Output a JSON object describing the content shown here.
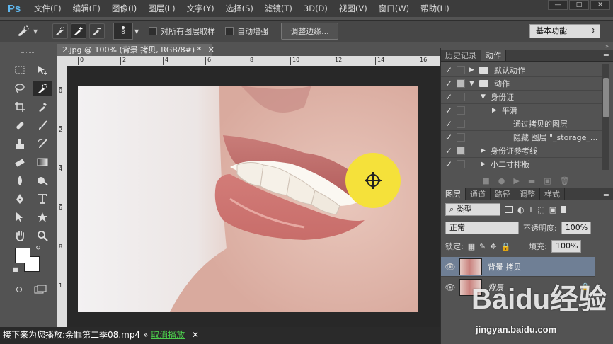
{
  "menubar": {
    "logo": "Ps",
    "items": [
      "文件(F)",
      "编辑(E)",
      "图像(I)",
      "图层(L)",
      "文字(Y)",
      "选择(S)",
      "滤镜(T)",
      "3D(D)",
      "视图(V)",
      "窗口(W)",
      "帮助(H)"
    ],
    "window_buttons": [
      "—",
      "□",
      "✕"
    ]
  },
  "optionsbar": {
    "brush_size": "8",
    "sample_all_layers": "对所有图层取样",
    "auto_enhance": "自动增强",
    "refine_edge": "调整边缘...",
    "workspace": "基本功能"
  },
  "document": {
    "tab_title": "2.jpg @ 100% (背景 拷贝, RGB/8#) *",
    "ruler_h": [
      "0",
      "2",
      "4",
      "6",
      "8",
      "10",
      "12",
      "14",
      "16",
      "18"
    ],
    "ruler_v": [
      "0",
      "2",
      "4",
      "6",
      "8",
      "1"
    ]
  },
  "history_panel": {
    "tabs": [
      "历史记录",
      "动作"
    ],
    "actions": [
      {
        "label": "默认动作",
        "check": "✓",
        "indent": 0,
        "arrow": "▶",
        "folder": true
      },
      {
        "label": "动作",
        "check": "✓",
        "indent": 0,
        "arrow": "▼",
        "folder": true
      },
      {
        "label": "身份证",
        "check": "✓",
        "indent": 1,
        "arrow": "▼",
        "folder": false
      },
      {
        "label": "平滑",
        "check": "✓",
        "indent": 2,
        "arrow": "▶",
        "folder": false
      },
      {
        "label": "通过拷贝的图层",
        "check": "✓",
        "indent": 3,
        "arrow": "",
        "folder": false
      },
      {
        "label": "隐藏 图层 \"_storage_...",
        "check": "✓",
        "indent": 3,
        "arrow": "",
        "folder": false
      },
      {
        "label": "身份证参考线",
        "check": "✓",
        "indent": 1,
        "arrow": "▶",
        "folder": false
      },
      {
        "label": "小二寸排版",
        "check": "✓",
        "indent": 1,
        "arrow": "▶",
        "folder": false
      }
    ]
  },
  "layers_panel": {
    "tabs": [
      "图层",
      "通道",
      "路径",
      "调整",
      "样式"
    ],
    "filter": "类型",
    "blend_mode": "正常",
    "opacity_label": "不透明度:",
    "opacity": "100%",
    "lock_label": "锁定:",
    "fill_label": "填充:",
    "fill": "100%",
    "layers": [
      {
        "name": "背景 拷贝",
        "selected": true,
        "locked": false
      },
      {
        "name": "背景",
        "selected": false,
        "locked": true
      }
    ]
  },
  "overlay": {
    "next_prefix": "接下来为您播放:余罪第二季08.mp4 »",
    "next_link": "取消播放",
    "close": "✕"
  },
  "watermark": {
    "logo": "Baidu经验",
    "url": "jingyan.baidu.com"
  },
  "colors": {
    "accent_blue": "#5fb8f0",
    "selected_layer": "#6f7f95",
    "cursor_yellow": "#f5e13a"
  }
}
